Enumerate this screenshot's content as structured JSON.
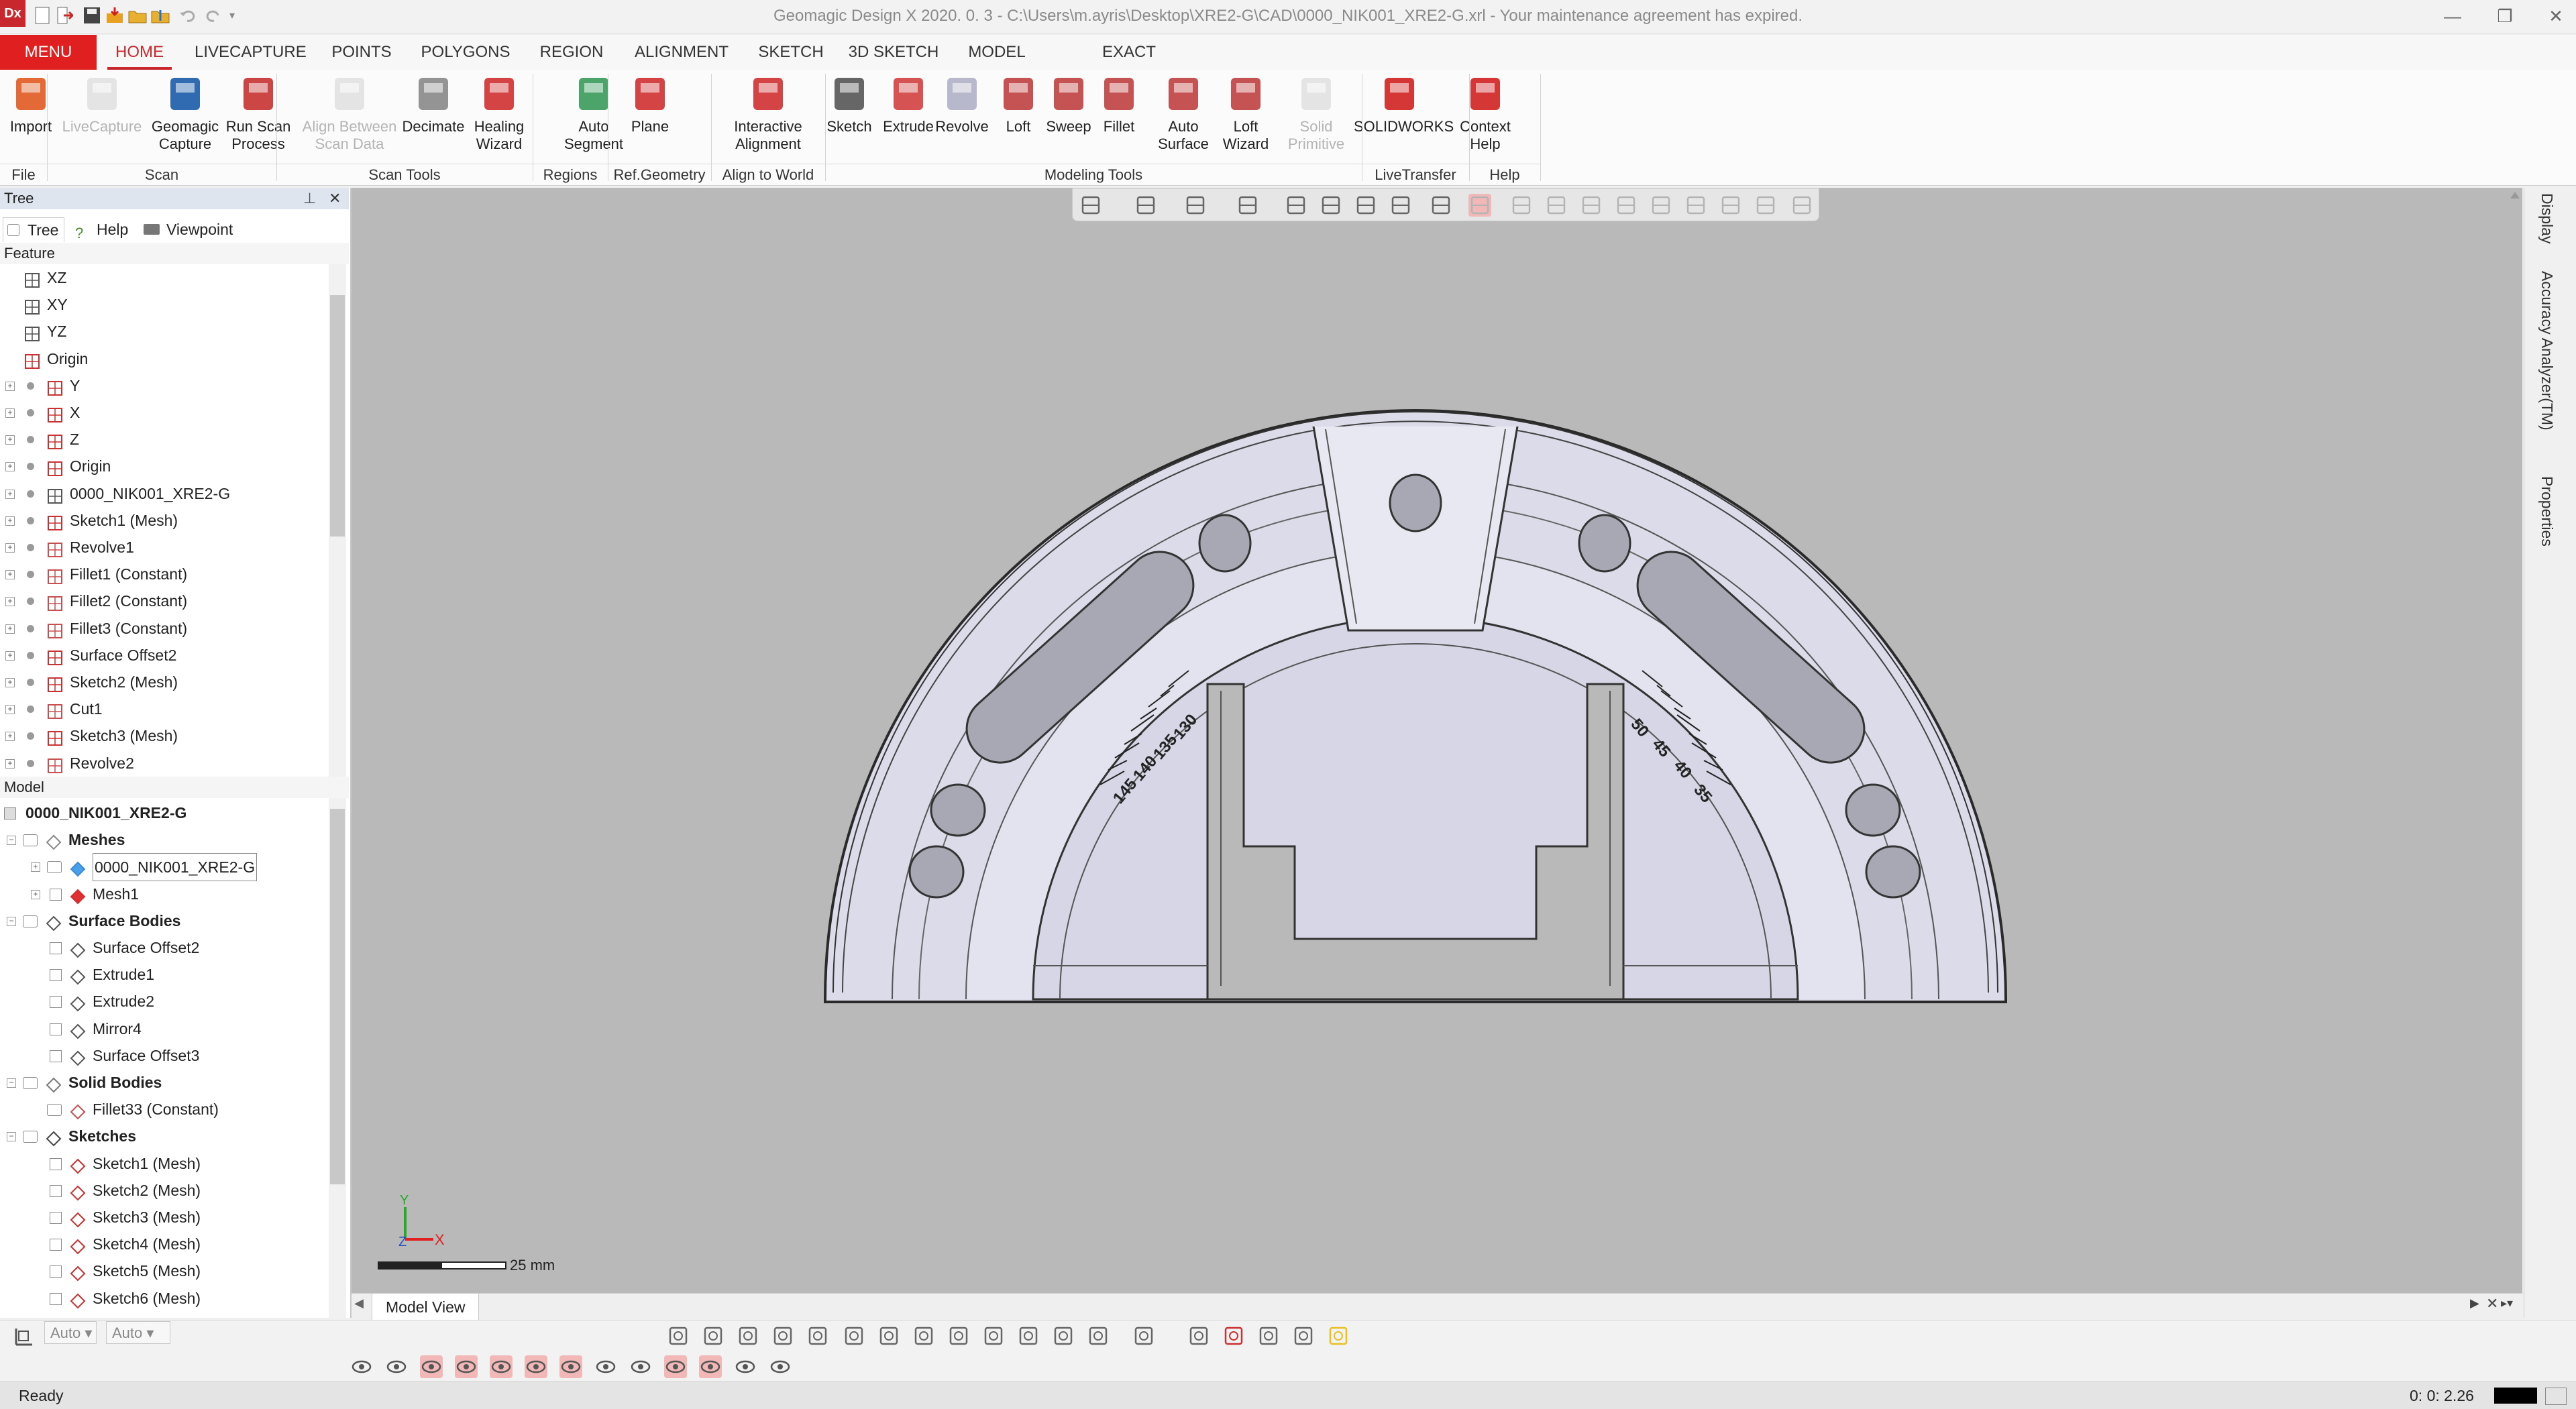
{
  "window": {
    "title": "Geomagic Design X 2020. 0. 3 - C:\\Users\\m.ayris\\Desktop\\XRE2-G\\CAD\\0000_NIK001_XRE2-G.xrl - Your maintenance agreement has expired.",
    "app_icon": "Dx"
  },
  "tabs": [
    "MENU",
    "HOME",
    "LIVECAPTURE",
    "POINTS",
    "POLYGONS",
    "REGION",
    "ALIGNMENT",
    "SKETCH",
    "3D SKETCH",
    "MODEL",
    "EXACT SURFACING"
  ],
  "active_tab": "HOME",
  "ribbon": {
    "buttons": [
      {
        "l1": "Import",
        "l2": "",
        "icon": "import-icon",
        "color": "#e05a20"
      },
      {
        "l1": "LiveCapture",
        "l2": "",
        "icon": "livecapture-icon",
        "color": "#c8c8c8",
        "disabled": true
      },
      {
        "l1": "Geomagic",
        "l2": "Capture",
        "icon": "geomagic-capture-icon",
        "color": "#1a5aa8"
      },
      {
        "l1": "Run Scan",
        "l2": "Process",
        "icon": "run-scan-process-icon",
        "color": "#c83232"
      },
      {
        "l1": "Align Between",
        "l2": "Scan Data",
        "icon": "align-between-scan-data-icon",
        "color": "#c8c8c8",
        "disabled": true
      },
      {
        "l1": "Decimate",
        "l2": "",
        "icon": "decimate-icon",
        "color": "#888888"
      },
      {
        "l1": "Healing",
        "l2": "Wizard",
        "icon": "healing-wizard-icon",
        "color": "#d03030"
      },
      {
        "l1": "Auto",
        "l2": "Segment",
        "icon": "auto-segment-icon",
        "color": "#3a9a5a"
      },
      {
        "l1": "Plane",
        "l2": "",
        "icon": "plane-icon",
        "color": "#d03030"
      },
      {
        "l1": "Interactive",
        "l2": "Alignment",
        "icon": "interactive-alignment-icon",
        "color": "#d03030"
      },
      {
        "l1": "Sketch",
        "l2": "",
        "icon": "sketch-icon",
        "color": "#555555"
      },
      {
        "l1": "Extrude",
        "l2": "",
        "icon": "extrude-icon",
        "color": "#d04040"
      },
      {
        "l1": "Revolve",
        "l2": "",
        "icon": "revolve-icon",
        "color": "#b0b0c8"
      },
      {
        "l1": "Loft",
        "l2": "",
        "icon": "loft-icon",
        "color": "#c04040"
      },
      {
        "l1": "Sweep",
        "l2": "",
        "icon": "sweep-icon",
        "color": "#c04040"
      },
      {
        "l1": "Fillet",
        "l2": "",
        "icon": "fillet-icon",
        "color": "#c04040"
      },
      {
        "l1": "Auto",
        "l2": "Surface",
        "icon": "auto-surface-icon",
        "color": "#c04040"
      },
      {
        "l1": "Loft",
        "l2": "Wizard",
        "icon": "loft-wizard-icon",
        "color": "#c04040"
      },
      {
        "l1": "Solid",
        "l2": "Primitive",
        "icon": "solid-primitive-icon",
        "color": "#c8c8c8",
        "disabled": true
      },
      {
        "l1": "SOLIDWORKS",
        "l2": "",
        "icon": "solidworks-icon",
        "color": "#d02020"
      },
      {
        "l1": "Context",
        "l2": "Help",
        "icon": "context-help-icon",
        "color": "#d02020"
      }
    ],
    "groups": [
      "File",
      "Scan",
      "Scan Tools",
      "Regions",
      "Ref.Geometry",
      "Align to World",
      "Modeling Tools",
      "LiveTransfer",
      "Help"
    ]
  },
  "panel": {
    "title": "Tree",
    "tabs": [
      "Tree",
      "Help",
      "Viewpoint"
    ],
    "feature_header": "Feature",
    "feature_items": [
      "XZ",
      "XY",
      "YZ",
      "Origin",
      "Y",
      "X",
      "Z",
      "Origin",
      "0000_NIK001_XRE2-G",
      "Sketch1 (Mesh)",
      "Revolve1",
      "Fillet1 (Constant)",
      "Fillet2 (Constant)",
      "Fillet3 (Constant)",
      "Surface Offset2",
      "Sketch2 (Mesh)",
      "Cut1",
      "Sketch3 (Mesh)",
      "Revolve2"
    ],
    "model_header": "Model",
    "model_items": [
      "0000_NIK001_XRE2-G",
      "Meshes",
      "0000_NIK001_XRE2-G",
      "Mesh1",
      "Surface Bodies",
      "Surface Offset2",
      "Extrude1",
      "Extrude2",
      "Mirror4",
      "Surface Offset3",
      "Solid Bodies",
      "Fillet33 (Constant)",
      "Sketches",
      "Sketch1 (Mesh)",
      "Sketch2 (Mesh)",
      "Sketch3 (Mesh)",
      "Sketch4 (Mesh)",
      "Sketch5 (Mesh)",
      "Sketch6 (Mesh)"
    ]
  },
  "viewport": {
    "scale_label": "25 mm",
    "triad": {
      "x": "X",
      "y": "Y",
      "z": "Z"
    },
    "scale_labels_left": [
      "145",
      "140",
      "135",
      "130"
    ],
    "scale_labels_right": [
      "50",
      "45",
      "40",
      "35"
    ]
  },
  "right_strip": [
    "Display",
    "Accuracy Analyzer(TM)",
    "Properties"
  ],
  "model_view_tab": "Model View",
  "combos": [
    "Auto",
    "Auto"
  ],
  "status": {
    "text": "Ready",
    "time": "0: 0: 2.26"
  }
}
